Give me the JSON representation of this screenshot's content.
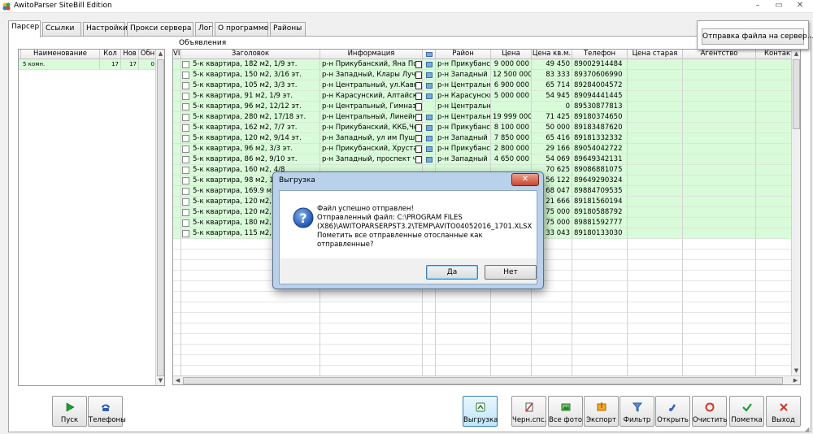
{
  "window": {
    "title": "AwitoParser SiteBill Edition",
    "minimize": "–",
    "maximize": "▭",
    "close": "✕"
  },
  "tabs": [
    "Парсер",
    "Ссылки",
    "Настройки",
    "Прокси сервера",
    "Лог",
    "О программе",
    "Районы"
  ],
  "upload_panel": {
    "button": "Отправка файла на сервер..."
  },
  "left_grid": {
    "columns": [
      "Наименование",
      "Кол",
      "Нов",
      "Обн"
    ],
    "rows": [
      [
        "5 комн.",
        "17",
        "17",
        "0"
      ]
    ]
  },
  "ads": {
    "label": "Объявления",
    "columns": [
      "VIP",
      "Заголовок",
      "Информация",
      "",
      "Район",
      "Цена",
      "Цена кв.м.",
      "Телефон",
      "Цена старая",
      "Агентство",
      "Контакт"
    ],
    "rows": [
      {
        "title": "5-к квартира, 182 м2, 1/9 эт.",
        "info": "р-н Прикубанский, Яна Пол",
        "flag": true,
        "district": "р-н Прикубанск",
        "price": "9 000 000",
        "sqm": "49 450",
        "phone": "89002914484"
      },
      {
        "title": "5-к квартира, 150 м2, 3/16 эт.",
        "info": "р-н Западный, Клары Лучко",
        "flag": true,
        "district": "р-н Западный",
        "price": "12 500 000",
        "sqm": "83 333",
        "phone": "89370606990"
      },
      {
        "title": "5-к квартира, 105 м2, 3/3 эт.",
        "info": "р-н Центральный, ул.Кавказ",
        "flag": true,
        "district": "р-н Центральны",
        "price": "6 900 000",
        "sqm": "65 714",
        "phone": "89284004572"
      },
      {
        "title": "5-к квартира, 91 м2, 1/9 эт.",
        "info": "р-н Карасунский, Алтайская",
        "flag": true,
        "district": "р-н Карасунский",
        "price": "5 000 000",
        "sqm": "54 945",
        "phone": "89094441445"
      },
      {
        "title": "5-к квартира, 96 м2, 12/12 эт.",
        "info": "р-н Центральный, Гимназич",
        "flag": false,
        "district": "р-н Центральны",
        "price": "",
        "sqm": "0",
        "phone": "89530877813"
      },
      {
        "title": "5-к квартира, 280 м2, 17/18 эт.",
        "info": "р-н Центральный, Линейная",
        "flag": true,
        "district": "р-н Центральны",
        "price": "19 999 000",
        "sqm": "71 425",
        "phone": "89180374650"
      },
      {
        "title": "5-к квартира, 162 м2, 7/7 эт.",
        "info": "р-н Прикубанский, ККБ,Черн",
        "flag": true,
        "district": "р-н Прикубанск",
        "price": "8 100 000",
        "sqm": "50 000",
        "phone": "89183487620"
      },
      {
        "title": "5-к квартира, 120 м2, 9/14 эт.",
        "info": "р-н Западный, ул им Пушкин",
        "flag": true,
        "district": "р-н Западный",
        "price": "7 850 000",
        "sqm": "65 416",
        "phone": "89181332332"
      },
      {
        "title": "5-к квартира, 96 м2, 3/3 эт.",
        "info": "р-н Прикубанский, Хрусталь",
        "flag": true,
        "district": "р-н Прикубанск",
        "price": "2 800 000",
        "sqm": "29 166",
        "phone": "89054042722"
      },
      {
        "title": "5-к квартира, 86 м2, 9/10 эт.",
        "info": "р-н Западный, проспект чек",
        "flag": true,
        "district": "р-н Западный",
        "price": "4 650 000",
        "sqm": "54 069",
        "phone": "89649342131"
      },
      {
        "title": "5-к квартира, 160 м2, 4/8",
        "info": "",
        "flag": false,
        "district": "",
        "price": "",
        "sqm": "70 625",
        "phone": "89086881075"
      },
      {
        "title": "5-к квартира, 98 м2, 1/9",
        "info": "",
        "flag": false,
        "district": "",
        "price": "",
        "sqm": "56 122",
        "phone": "89649290324"
      },
      {
        "title": "5-к квартира, 169.9 м2,",
        "info": "",
        "flag": false,
        "district": "",
        "price": "",
        "sqm": "68 047",
        "phone": "89884709535"
      },
      {
        "title": "5-к квартира, 120 м2, 3/",
        "info": "",
        "flag": false,
        "district": "",
        "price": "",
        "sqm": "21 666",
        "phone": "89181560194"
      },
      {
        "title": "5-к квартира, 120 м2, 9/",
        "info": "",
        "flag": false,
        "district": "",
        "price": "",
        "sqm": "75 000",
        "phone": "89180588792"
      },
      {
        "title": "5-к квартира, 180 м2, 6/",
        "info": "",
        "flag": false,
        "district": "",
        "price": "",
        "sqm": "75 000",
        "phone": "89881592777"
      },
      {
        "title": "5-к квартира, 115 м2, 5/",
        "info": "",
        "flag": false,
        "district": "",
        "price": "",
        "sqm": "33 043",
        "phone": "89180133030"
      }
    ]
  },
  "left_buttons": [
    {
      "label": "Пуск",
      "icon": "play-icon"
    },
    {
      "label": "Телефоны",
      "icon": "phone-icon"
    }
  ],
  "toolbar": [
    {
      "label": "Выгрузка",
      "icon": "upload-icon",
      "pressed": true
    },
    {
      "label": "Черн.спс.",
      "icon": "blacklist-icon"
    },
    {
      "label": "Все фото",
      "icon": "photos-icon"
    },
    {
      "label": "Экспорт",
      "icon": "export-icon"
    },
    {
      "label": "Фильтр",
      "icon": "filter-icon"
    },
    {
      "label": "Открыть",
      "icon": "open-icon"
    },
    {
      "label": "Очистить",
      "icon": "clear-icon"
    },
    {
      "label": "Пометка",
      "icon": "mark-icon"
    },
    {
      "label": "Выход",
      "icon": "exit-icon"
    }
  ],
  "dialog": {
    "title": "Выгрузка",
    "close": "✕",
    "lines": [
      "Файл успешно отправлен!",
      "Отправленный файл: C:\\PROGRAM FILES",
      "(X86)\\AWITOPARSERPST3.2\\TEMP\\AVITO04052016_1701.XLSX",
      "Пометить все отправленные отосланные как отправленные?"
    ],
    "yes": "Да",
    "no": "Нет"
  },
  "colors": {
    "row_green": "#d9fbd9",
    "dialog_frame": "#b9d1ea",
    "close_red": "#c74a30"
  }
}
